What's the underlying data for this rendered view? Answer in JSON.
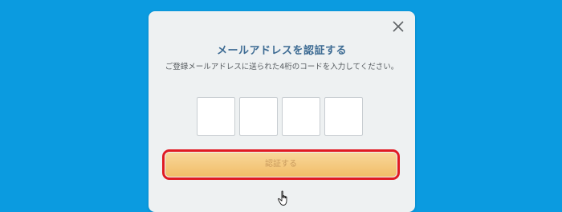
{
  "modal": {
    "title": "メールアドレスを認証する",
    "description": "ご登録メールアドレスに送られた4桁のコードを入力してください。",
    "code_inputs": [
      "",
      "",
      "",
      ""
    ],
    "verify_button_label": "認証する"
  },
  "colors": {
    "background": "#0b9be0",
    "modal_background": "#eef1f2",
    "title": "#3d6b93",
    "button_gradient_top": "#f8d79a",
    "button_gradient_bottom": "#f1bd68",
    "highlight_border": "#e01a22"
  },
  "icons": {
    "close": "close-icon",
    "cursor": "hand-pointer-icon"
  }
}
